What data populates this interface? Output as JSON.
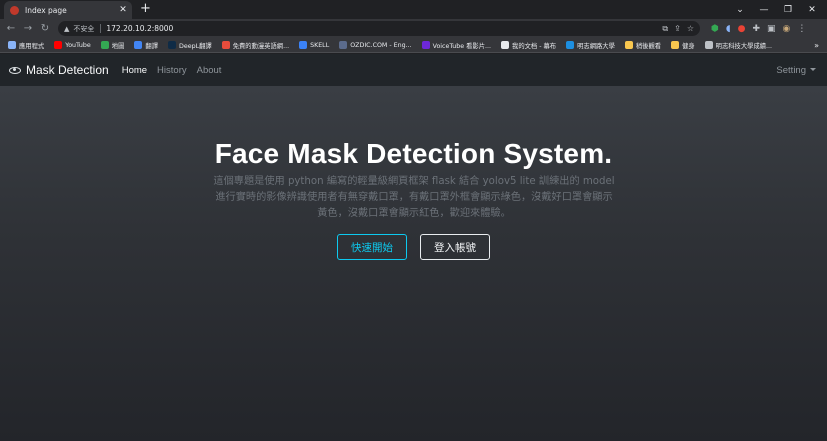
{
  "browser": {
    "tab_title": "Index page",
    "tab_close": "✕",
    "new_tab": "+",
    "window_controls": [
      "⌄",
      "—",
      "❐",
      "✕"
    ],
    "security_label": "不安全",
    "url": "172.20.10.2:8000"
  },
  "bookmarks": [
    {
      "label": "應用程式",
      "icon": "apps-grid-icon",
      "color": "#8ab4f8"
    },
    {
      "label": "YouTube",
      "icon": "youtube-icon",
      "color": "#ff0000"
    },
    {
      "label": "地圖",
      "icon": "maps-pin-icon",
      "color": "#34a853"
    },
    {
      "label": "翻譯",
      "icon": "translate-icon",
      "color": "#4285f4"
    },
    {
      "label": "DeepL翻譯",
      "icon": "deepl-icon",
      "color": "#0f2b46"
    },
    {
      "label": "免費的動漫英語網...",
      "icon": "anime-english-icon",
      "color": "#e74c3c"
    },
    {
      "label": "SKELL",
      "icon": "skell-icon",
      "color": "#3b82f6"
    },
    {
      "label": "OZDIC.COM - Eng...",
      "icon": "ozdic-icon",
      "color": "#5b6b8c"
    },
    {
      "label": "VoiceTube 看影片...",
      "icon": "voicetube-icon",
      "color": "#6d28d9"
    },
    {
      "label": "我的文档 - 幕布",
      "icon": "mubu-icon",
      "color": "#e8eaed"
    },
    {
      "label": "明志網路大學",
      "icon": "mcut-online-icon",
      "color": "#1d8fe1"
    },
    {
      "label": "稍後觀看",
      "icon": "folder-icon",
      "color": "#f9c74f"
    },
    {
      "label": "健身",
      "icon": "folder-icon",
      "color": "#f9c74f"
    },
    {
      "label": "明志科技大學成績...",
      "icon": "globe-icon",
      "color": "#bdc1c6"
    }
  ],
  "bookmarks_more": "»",
  "site": {
    "brand": "Mask Detection",
    "nav": [
      "Home",
      "History",
      "About"
    ],
    "setting": "Setting"
  },
  "hero": {
    "title": "Face Mask Detection System.",
    "description": "這個專題是使用 python 編寫的輕量級網頁框架 flask 結合 yolov5 lite 訓練出的 model 進行實時的影像辨識使用者有無穿戴口罩，有戴口罩外框會顯示綠色，沒戴好口罩會顯示黃色，沒戴口罩會顯示紅色，歡迎來體驗。",
    "start_button": "快速開始",
    "login_button": "登入帳號"
  },
  "colors": {
    "accent": "#0dcaf0",
    "navbar": "#212529",
    "text_muted": "#6b7178"
  }
}
